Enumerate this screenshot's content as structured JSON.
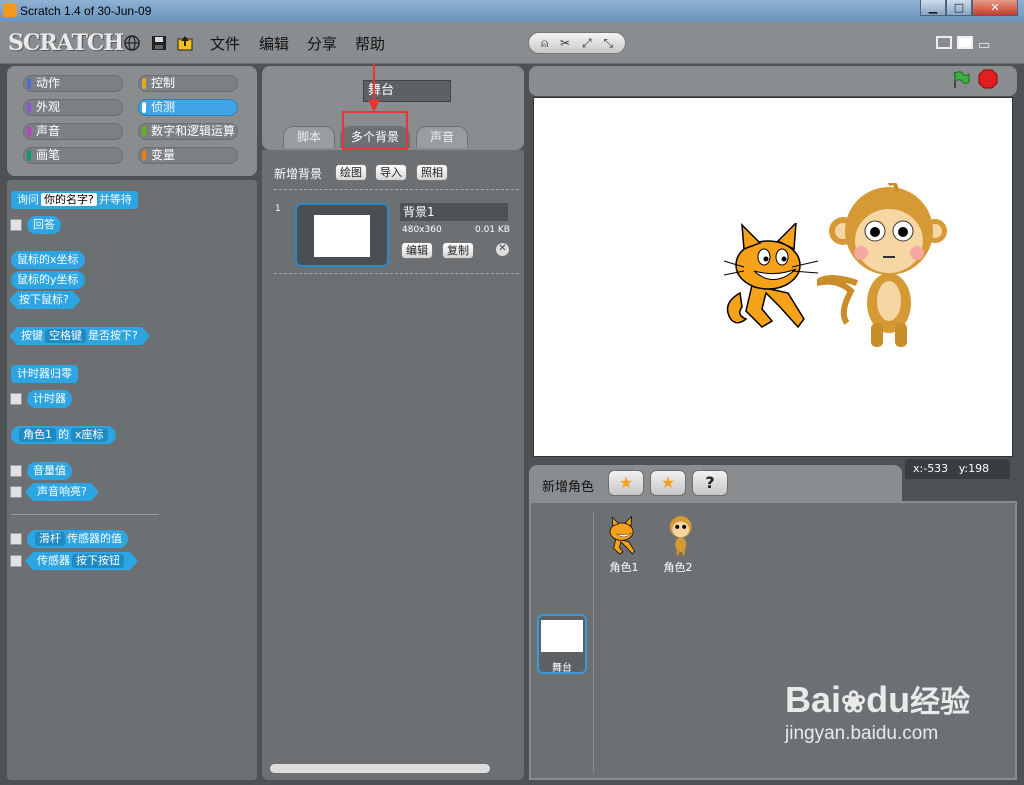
{
  "window": {
    "title": "Scratch 1.4 of 30-Jun-09",
    "min": "▁",
    "max": "□",
    "close": "✕"
  },
  "topbar": {
    "logo": "SCRATCH",
    "menus": [
      "文件",
      "编辑",
      "分享",
      "帮助"
    ],
    "mode_icons": [
      "person-icon",
      "wrench-icon",
      "grow-icon",
      "shrink-icon"
    ]
  },
  "categories": [
    {
      "label": "动作",
      "color": "#4a6cd4"
    },
    {
      "label": "控制",
      "color": "#e1a91a"
    },
    {
      "label": "外观",
      "color": "#8a55d7"
    },
    {
      "label": "侦测",
      "color": "#2ca5e2"
    },
    {
      "label": "声音",
      "color": "#bb42c3"
    },
    {
      "label": "数字和逻辑运算",
      "color": "#5cb712"
    },
    {
      "label": "画笔",
      "color": "#0e9a6c"
    },
    {
      "label": "变量",
      "color": "#ee7d16"
    }
  ],
  "blocks": {
    "ask": {
      "pre": "询问",
      "slot": "你的名字?",
      "post": "并等待"
    },
    "answer": "回答",
    "mouse_x": "鼠标的x坐标",
    "mouse_y": "鼠标的y坐标",
    "mouse_down": "按下鼠标?",
    "key": {
      "pre": "按键",
      "dd": "空格键",
      "post": "是否按下?"
    },
    "timer_reset": "计时器归零",
    "timer": "计时器",
    "of": {
      "dd1": "角色1",
      "mid": "的",
      "dd2": "x座标"
    },
    "loudness": "音量值",
    "loud": "声音响亮?",
    "sensor_val": {
      "dd": "滑杆",
      "post": "传感器的值"
    },
    "sensor": {
      "pre": "传感器",
      "dd": "按下按钮"
    }
  },
  "middle": {
    "object_name": "舞台",
    "tabs": [
      "脚本",
      "多个背景",
      "声音"
    ],
    "new_bg_label": "新增背景",
    "buttons": [
      "绘图",
      "导入",
      "照相"
    ],
    "bg_item": {
      "index": "1",
      "name": "背景1",
      "size": "480x360",
      "filesize": "0.01 KB",
      "edit": "编辑",
      "copy": "复制"
    }
  },
  "stage": {
    "x_label": "x:",
    "x": "-533",
    "y_label": "y:",
    "y": "198"
  },
  "sprites": {
    "new_label": "新增角色",
    "items": [
      {
        "name": "角色1"
      },
      {
        "name": "角色2"
      }
    ],
    "stage_label": "舞台"
  },
  "watermark": {
    "brand": "Bai",
    "brand2": "du",
    "brand3": "经验",
    "url": "jingyan.baidu.com"
  }
}
